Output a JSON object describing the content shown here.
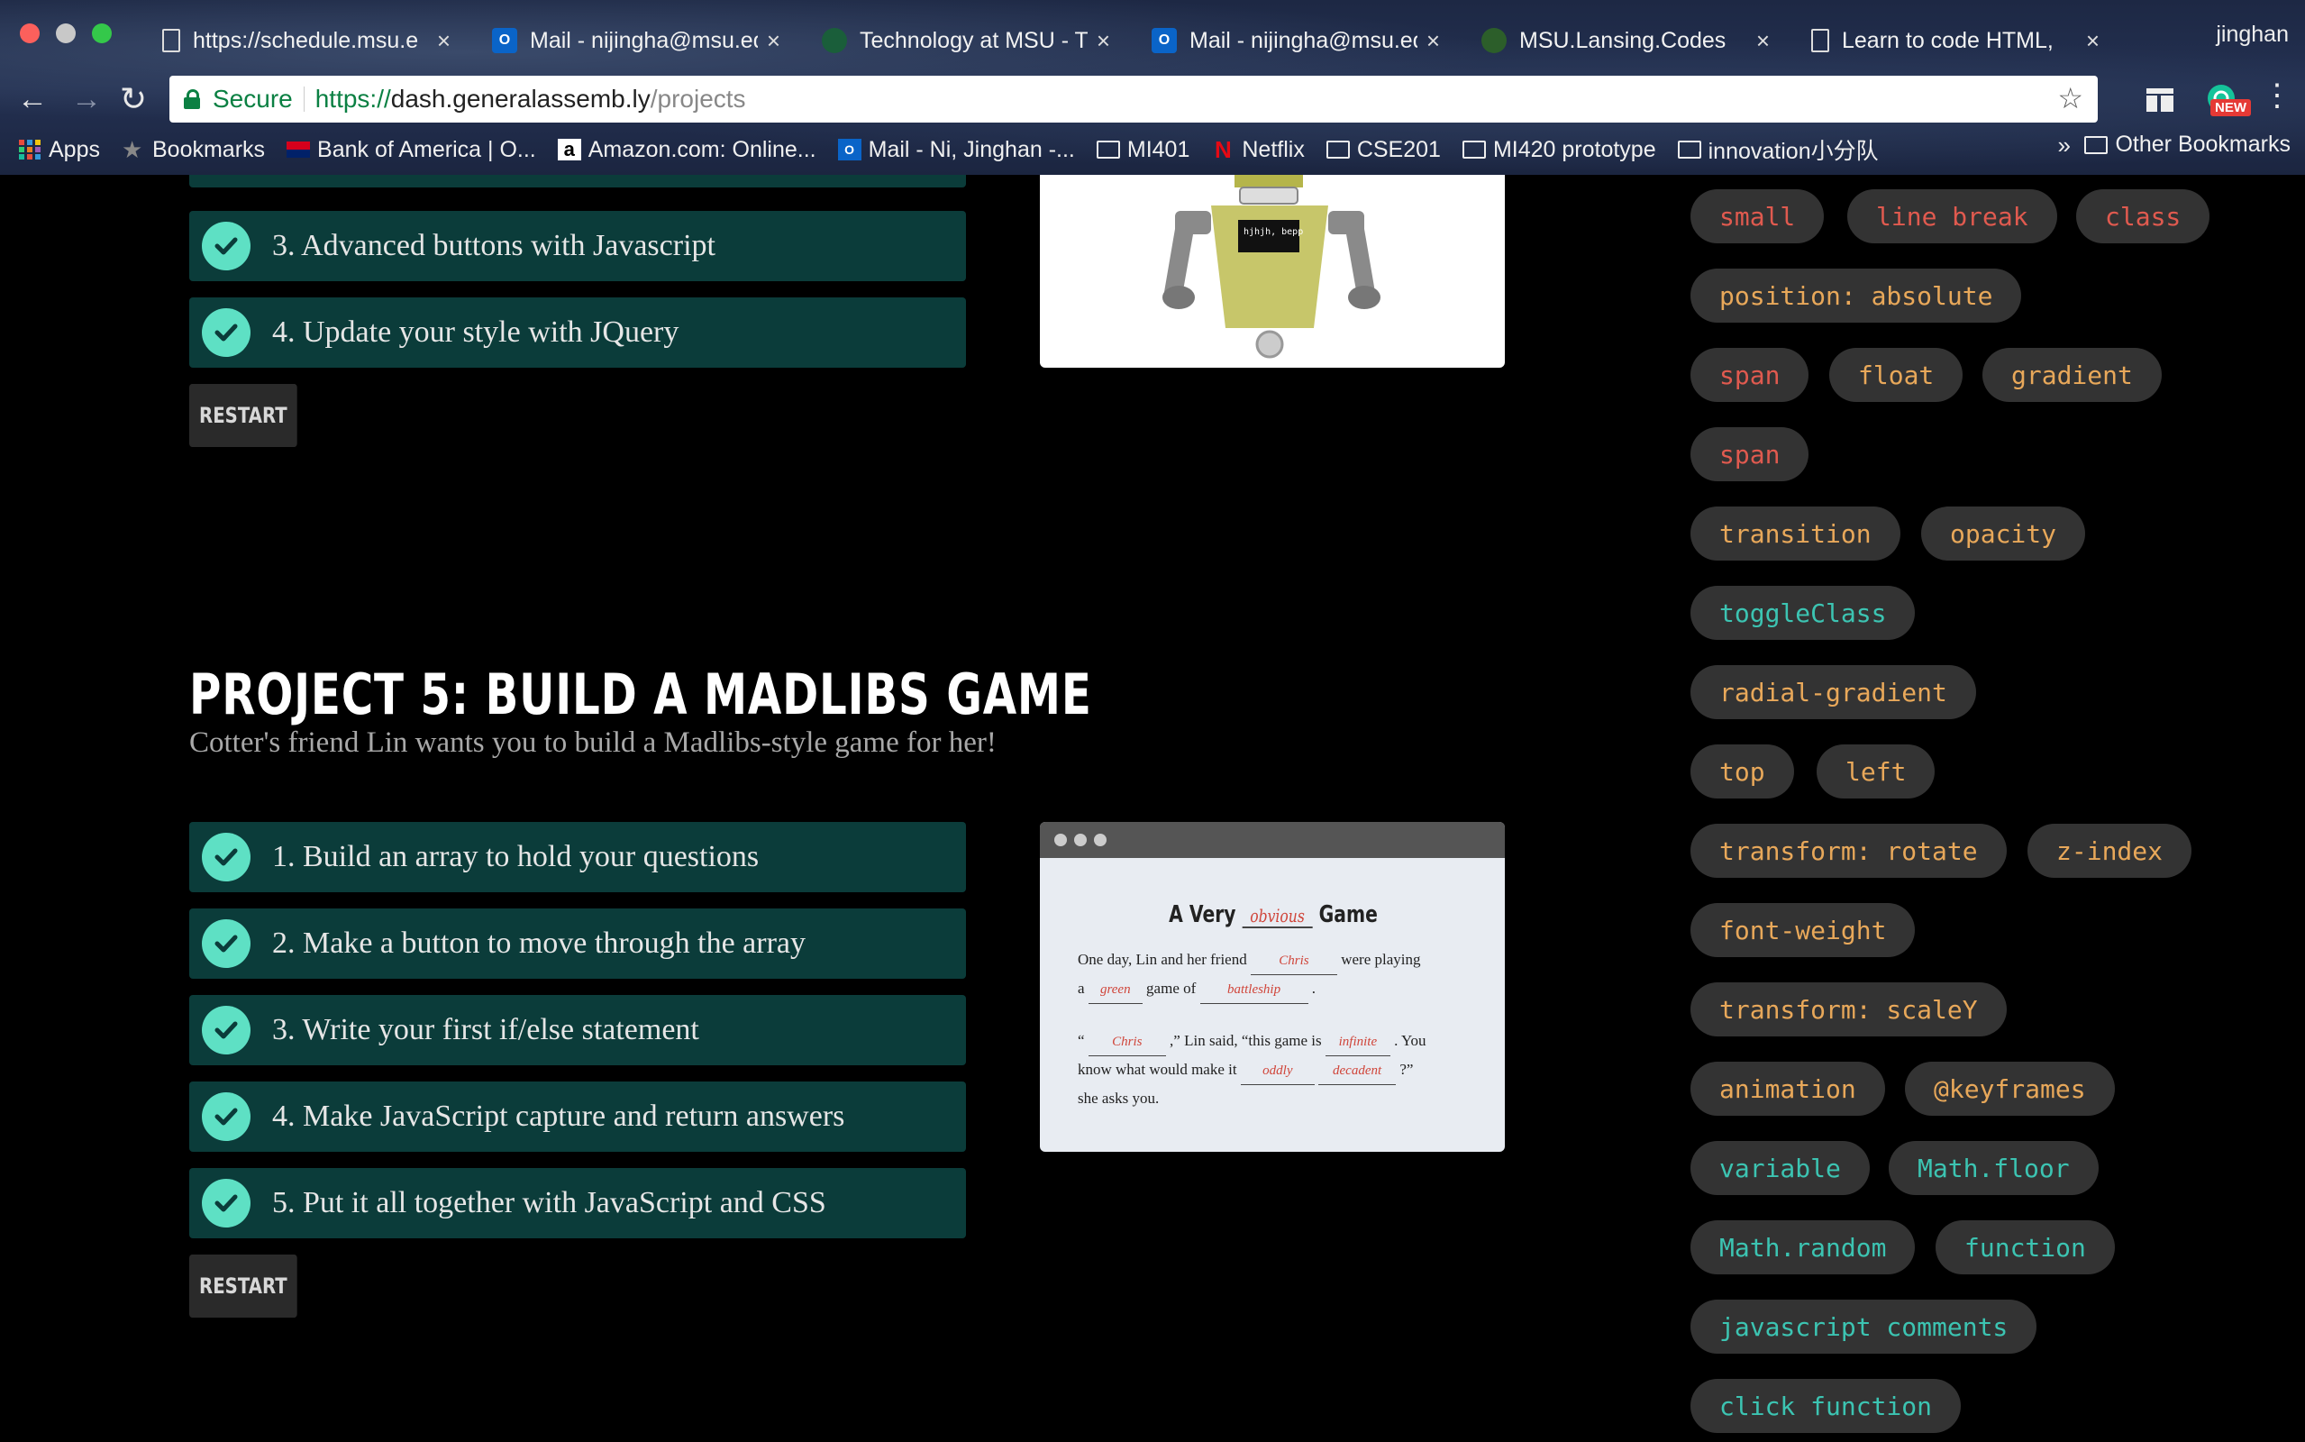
{
  "browser": {
    "tabs": [
      {
        "title": "https://schedule.msu.e",
        "icon": "page-icon"
      },
      {
        "title": "Mail - nijingha@msu.ed",
        "icon": "outlook-icon"
      },
      {
        "title": "Technology at MSU - T",
        "icon": "msu-spartan-icon"
      },
      {
        "title": "Mail - nijingha@msu.ed",
        "icon": "outlook-icon"
      },
      {
        "title": "MSU.Lansing.Codes",
        "icon": "spartan-code-icon"
      },
      {
        "title": "Learn to code HTML,",
        "icon": "page-icon"
      }
    ],
    "tab_close": "×",
    "profile_name": "jinghan",
    "secure_label": "Secure",
    "url_scheme": "https://",
    "url_host": "dash.generalassemb.ly",
    "url_path": "/projects",
    "extension_badge": "NEW",
    "bookmarks": [
      {
        "label": "Apps",
        "icon": "apps-grid-icon"
      },
      {
        "label": "Bookmarks",
        "icon": "star-icon"
      },
      {
        "label": "Bank of America | O...",
        "icon": "bofa-icon"
      },
      {
        "label": "Amazon.com: Online...",
        "icon": "amazon-icon"
      },
      {
        "label": "Mail - Ni, Jinghan -...",
        "icon": "outlook-icon"
      },
      {
        "label": "MI401",
        "icon": "folder-icon"
      },
      {
        "label": "Netflix",
        "icon": "netflix-icon"
      },
      {
        "label": "CSE201",
        "icon": "folder-icon"
      },
      {
        "label": "MI420 prototype",
        "icon": "folder-icon"
      },
      {
        "label": "innovation小分队",
        "icon": "folder-icon"
      }
    ],
    "bookmarks_more": "»",
    "other_bookmarks": "Other Bookmarks"
  },
  "project4": {
    "tasks": [
      {
        "label": "3. Advanced buttons with Javascript"
      },
      {
        "label": "4. Update your style with JQuery"
      }
    ],
    "restart_label": "RESTART",
    "robot_sign_text": "hjhjh, bepp"
  },
  "project5": {
    "title": "PROJECT 5: BUILD A MADLIBS GAME",
    "subtitle": "Cotter's friend Lin wants you to build a Madlibs-style game for her!",
    "tasks": [
      {
        "label": "1. Build an array to hold your questions"
      },
      {
        "label": "2. Make a button to move through the array"
      },
      {
        "label": "3. Write your first if/else statement"
      },
      {
        "label": "4. Make JavaScript capture and return answers"
      },
      {
        "label": "5. Put it all together with JavaScript and CSS"
      }
    ],
    "restart_label": "RESTART",
    "preview": {
      "heading_a": "A Very",
      "heading_blank": "obvious",
      "heading_b": "Game",
      "l1a": "One day, Lin and her friend",
      "l1blank": "Chris",
      "l1b": "were playing",
      "l2a": "a",
      "l2blank1": "green",
      "l2b": "game of",
      "l2blank2": "battleship",
      "l2c": ".",
      "l3a": "“",
      "l3blank1": "Chris",
      "l3b": ",” Lin said, “this game is",
      "l3blank2": "infinite",
      "l3c": ". You",
      "l4a": "know what would make it",
      "l4blank1": "oddly",
      "l4blank2": "decadent",
      "l4b": "?”",
      "l5": "she asks you."
    }
  },
  "tags": [
    {
      "label": "small",
      "color": "red"
    },
    {
      "label": "line break",
      "color": "red"
    },
    {
      "label": "class",
      "color": "red"
    },
    {
      "label": "position: absolute",
      "color": "orange"
    },
    {
      "label": "span",
      "color": "red"
    },
    {
      "label": "float",
      "color": "orange"
    },
    {
      "label": "gradient",
      "color": "orange"
    },
    {
      "label": "span",
      "color": "red"
    },
    {
      "label": "transition",
      "color": "orange"
    },
    {
      "label": "opacity",
      "color": "orange"
    },
    {
      "label": "toggleClass",
      "color": "teal"
    },
    {
      "label": "radial-gradient",
      "color": "orange"
    },
    {
      "label": "top",
      "color": "orange"
    },
    {
      "label": "left",
      "color": "orange"
    },
    {
      "label": "transform: rotate",
      "color": "orange"
    },
    {
      "label": "z-index",
      "color": "orange"
    },
    {
      "label": "font-weight",
      "color": "orange"
    },
    {
      "label": "transform: scaleY",
      "color": "orange"
    },
    {
      "label": "animation",
      "color": "orange"
    },
    {
      "label": "@keyframes",
      "color": "orange"
    },
    {
      "label": "variable",
      "color": "teal"
    },
    {
      "label": "Math.floor",
      "color": "teal"
    },
    {
      "label": "Math.random",
      "color": "teal"
    },
    {
      "label": "function",
      "color": "teal"
    },
    {
      "label": "javascript comments",
      "color": "teal"
    },
    {
      "label": "click function",
      "color": "teal"
    }
  ],
  "colors": {
    "task_bg": "#0b3c3a",
    "check": "#5ee0c4",
    "tag_bg": "#333333",
    "tag_red": "#e05a4f",
    "tag_orange": "#e8a85a",
    "tag_teal": "#3cc4b2"
  }
}
